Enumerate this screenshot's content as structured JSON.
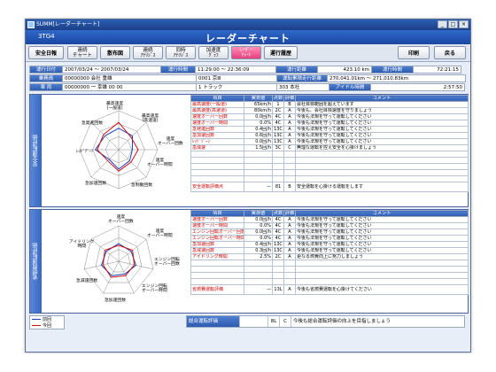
{
  "window_title": "SUMM[レーダーチャート]",
  "window_controls": [
    "_",
    "□",
    "×"
  ],
  "header": {
    "left": "3TG4",
    "title": "レーダーチャート"
  },
  "toolbar": {
    "safe_label": "安全日報",
    "continuous_label": "連続\nチャート",
    "pace_label": "散布図",
    "continuous_analysis_label": "連続\nｱﾅﾘｼﾞｽ",
    "sametime_label": "同時\nｱﾅﾘｼﾞｽ",
    "accel_label": "加速度\nｸﾞﾗﾌ",
    "radar_label": "ﾚｰﾀﾞｰ\nﾁｬｰﾄ",
    "history_label": "運行履歴",
    "print_label": "印刷",
    "back_label": "戻る"
  },
  "info_rows": [
    [
      {
        "l": "運行日付"
      },
      {
        "v": "2007/03/24 ～ 2007/03/24"
      },
      {
        "l": "運行時間"
      },
      {
        "v": "11:29:00 ～ 22:36:09"
      },
      {
        "l": "運行距離"
      },
      {
        "v": "423.10 km"
      },
      {
        "l": "運行時間"
      },
      {
        "v": "72:21:15"
      }
    ],
    [
      {
        "l": "乗務員"
      },
      {
        "v": "00000000 会社 重雄"
      },
      {
        "v": "0001 京Ⅲ"
      },
      {
        "l": "運転累積走行距離"
      },
      {
        "v": "270,041.01km ～ 271,010.83km"
      }
    ],
    [
      {
        "l": "車 両"
      },
      {
        "v": "00000000 一 幸雄 00 00"
      },
      {
        "v": "1 トラック"
      },
      {
        "v": "303 本社"
      },
      {
        "l": "アイドル時間"
      },
      {
        "v": "2:57:50"
      }
    ]
  ],
  "upper": {
    "side_label": "安全運転評価",
    "radar_labels": [
      "最高速度\n(一般道)",
      "最高速度\n(高速道)",
      "速度\nオーバー回数",
      "速度\nオーバー時間",
      "急制動回数",
      "急加速回数",
      "ﾚｯﾄﾞｿﾞｰﾝ",
      "急発進回数"
    ],
    "headers": [
      "項目",
      "実測値",
      "点数",
      "評価",
      "コメント"
    ],
    "rows": [
      [
        "最高速度(一般道)",
        "65km/h",
        "1",
        "B",
        "会社目標範囲を超えています"
      ],
      [
        "最高速度(高速道)",
        "80km/h",
        "2C",
        "A",
        "今後も、会社目標速度を守りましょう"
      ],
      [
        "速度オーバー回数",
        "0.0回/h",
        "4C",
        "A",
        "今後も法規を守って運転してください"
      ],
      [
        "速度オーバー時間",
        "0.0%",
        "4C",
        "A",
        "今後も法規を守って運転してください"
      ],
      [
        "急発進回数",
        "0.4回/h",
        "13C",
        "A",
        "今後も法規を守って運転してください"
      ],
      [
        "急加速回数",
        "0.6回/h",
        "13C",
        "A",
        "今後も法規を守って運転してください"
      ],
      [
        "ﾚｯﾄﾞｿﾞｰﾝ",
        "0.0回/h",
        "13C",
        "A",
        "今後も法規を守って運転してください"
      ],
      [
        "急減速",
        "1.5回/h",
        "3C",
        "C",
        "無理な運転を控え安全を心掛けましょう"
      ],
      [
        "",
        "",
        "",
        "",
        ""
      ],
      [
        "",
        "",
        "",
        "",
        ""
      ],
      [
        "",
        "",
        "",
        "",
        ""
      ],
      [
        "",
        "",
        "",
        "",
        ""
      ],
      [
        "",
        "",
        "",
        "",
        ""
      ]
    ],
    "total": [
      "安全運転評価点",
      "—",
      "81",
      "B",
      "安全運転を心掛ける運転をします"
    ]
  },
  "lower": {
    "side_label": "省燃費運転評価",
    "radar_labels": [
      "速度\nオーバー回数",
      "速度\nオーバー時間",
      "エンジン回転\nオーバー回数",
      "エンジン回転\nオーバー時間",
      "急加速回数",
      "急減速回数",
      "アイドリング\n時間"
    ],
    "headers": [
      "項目",
      "実測値",
      "点数",
      "評価",
      "コメント"
    ],
    "rows": [
      [
        "速度オーバー回数",
        "0.0回/h",
        "4C",
        "A",
        "今後も法規を守って運転してください"
      ],
      [
        "速度オーバー時間",
        "0.0%",
        "4C",
        "A",
        "今後も法規を守って運転してください"
      ],
      [
        "エンジン回転オーバー回数",
        "0.0回/h",
        "4C",
        "A",
        "今後も法規を守って運転してください"
      ],
      [
        "エンジン回転オーバー時間",
        "0.0%",
        "4C",
        "A",
        "今後も法規を守って運転してください"
      ],
      [
        "急加速回数",
        "0.4回/h",
        "13C",
        "A",
        "今後も法規を守って運転してください"
      ],
      [
        "急減速回数",
        "0.3回/h",
        "13C",
        "A",
        "今後も法規を守って運転してください"
      ],
      [
        "アイドリング時間",
        "2.5%",
        "2C",
        "A",
        "更なる燃費向上に努力しましょう"
      ],
      [
        "",
        "",
        "",
        "",
        ""
      ],
      [
        "",
        "",
        "",
        "",
        ""
      ],
      [
        "",
        "",
        "",
        "",
        ""
      ],
      [
        "",
        "",
        "",
        "",
        ""
      ]
    ],
    "total": [
      "省燃費運転評価",
      "—",
      "13L",
      "A",
      "今後も省燃費運転を心掛けてください"
    ]
  },
  "legend": [
    {
      "label": "前回",
      "color": "#1a3fbf"
    },
    {
      "label": "今回",
      "color": "#d01010"
    }
  ],
  "overall": [
    "総合運転評価",
    "",
    "8L",
    "C",
    "今後も総合運転評価の向上を目指しましょう"
  ]
}
